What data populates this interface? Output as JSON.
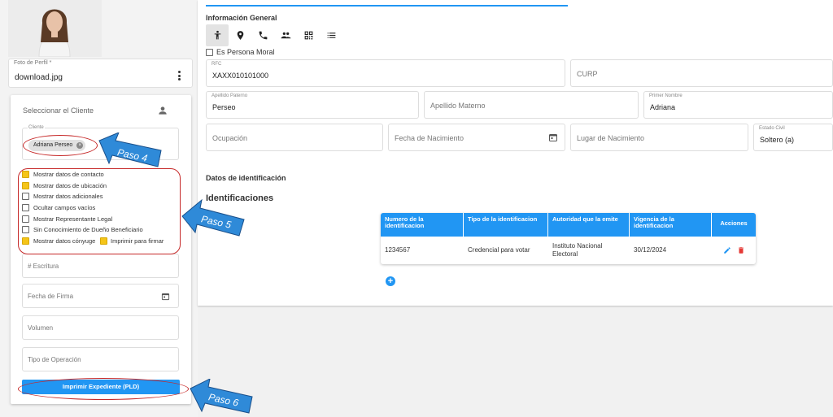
{
  "profile": {
    "field_label": "Foto de Perfil *",
    "file_name": "download.jpg"
  },
  "client_panel": {
    "header": "Seleccionar el Cliente",
    "client_label": "Cliente",
    "client_chip": "Adriana Perseo",
    "checkboxes": [
      {
        "label": "Mostrar datos de contacto",
        "checked": true
      },
      {
        "label": "Mostrar datos de ubicación",
        "checked": true
      },
      {
        "label": "Mostrar datos adicionales",
        "checked": false
      },
      {
        "label": "Ocultar campos vacíos",
        "checked": false
      },
      {
        "label": "Mostrar Representante Legal",
        "checked": false
      },
      {
        "label": "Sin Conocimiento de Dueño Beneficiario",
        "checked": false
      },
      {
        "label": "Mostrar datos cónyuge",
        "checked": true
      }
    ],
    "print_to_sign": {
      "label": "Imprimir para firmar",
      "checked": true
    },
    "fields": {
      "escritura": "# Escritura",
      "fecha_firma": "Fecha de Firma",
      "volumen": "Volumen",
      "tipo_operacion": "Tipo de Operación"
    },
    "print_button": "Imprimir Expediente (PLD)"
  },
  "main": {
    "section_title": "Información General",
    "tabs": [
      "person-icon",
      "location-pin-icon",
      "phone-icon",
      "people-icon",
      "qr-code-icon",
      "list-icon"
    ],
    "persona_moral": {
      "label": "Es Persona Moral",
      "checked": false
    },
    "rfc": {
      "label": "RFC",
      "value": "XAXX010101000"
    },
    "curp": {
      "placeholder": "CURP"
    },
    "apellido_paterno": {
      "label": "Apellido Paterno",
      "value": "Perseo"
    },
    "apellido_materno": {
      "placeholder": "Apellido Materno"
    },
    "primer_nombre": {
      "label": "Primer Nombre",
      "value": "Adriana"
    },
    "ocupacion": {
      "placeholder": "Ocupación"
    },
    "fecha_nacimiento": {
      "placeholder": "Fecha de Nacimiento"
    },
    "lugar_nacimiento": {
      "placeholder": "Lugar de Nacimiento"
    },
    "estado_civil": {
      "label": "Estado Civil",
      "value": "Soltero (a)"
    },
    "datos_identificacion": "Datos de identificación",
    "identificaciones_title": "Identificaciones",
    "table": {
      "headers": [
        "Numero de la identificacion",
        "Tipo de la identificacion",
        "Autoridad que la emite",
        "Vigencia de la identificacion",
        "Acciones"
      ],
      "rows": [
        [
          "1234567",
          "Credencial para votar",
          "Instituto Nacional Electoral",
          "30/12/2024"
        ]
      ]
    }
  },
  "annotations": {
    "paso4": "Paso 4",
    "paso5": "Paso 5",
    "paso6": "Paso 6"
  },
  "colors": {
    "accent": "#2196f3",
    "checkbox_checked": "#f5c518",
    "annotation_red": "#c62828",
    "delete_red": "#e53935"
  }
}
